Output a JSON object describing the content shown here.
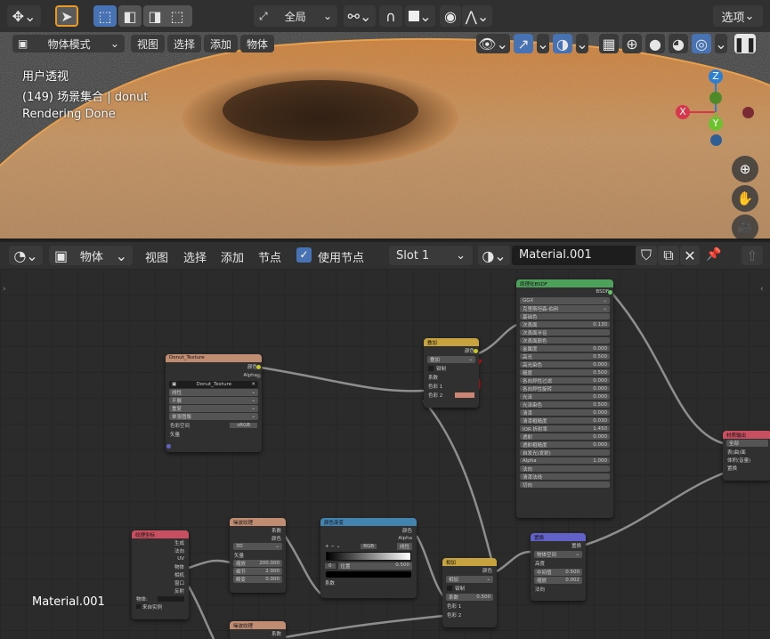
{
  "topbar": {
    "transform_orientation": "全局",
    "options_label": "选项"
  },
  "viewport": {
    "mode": "物体模式",
    "menus": [
      "视图",
      "选择",
      "添加",
      "物体"
    ],
    "overlay_lines": [
      "用户透视",
      "(149) 场景集合 | donut",
      "Rendering Done"
    ],
    "gizmo": {
      "z": "Z",
      "y": "Y",
      "x": "X"
    }
  },
  "node_header": {
    "object_label": "物体",
    "menus": [
      "视图",
      "选择",
      "添加",
      "节点"
    ],
    "use_nodes_label": "使用节点",
    "use_nodes_checked": true,
    "slot": "Slot 1",
    "material": "Material.001"
  },
  "material_name_overlay": "Material.001",
  "nodes": {
    "image_texture": {
      "title": "Donut_Texture",
      "out_color": "颜色",
      "out_alpha": "Alpha",
      "image": "Donut_Texture",
      "interp": "线性",
      "proj": "平展",
      "ext": "重复",
      "source": "单张图像",
      "colorspace_label": "色彩空间",
      "colorspace": "sRGB",
      "in_vector": "矢量"
    },
    "mix1": {
      "title": "叠加",
      "out": "颜色",
      "blend": "叠加",
      "clamp": "钳制",
      "factor": "系数",
      "c1": "色彩 1",
      "c2": "色彩 2"
    },
    "bsdf": {
      "title": "原理化BSDF",
      "out": "BSDF",
      "dist": "GGX",
      "sss_method": "克里斯坦森-伯利",
      "rows": [
        [
          "基础色",
          ""
        ],
        [
          "次表面",
          "0.130"
        ],
        [
          "次表面半径",
          ""
        ],
        [
          "次表面颜色",
          ""
        ],
        [
          "金属度",
          "0.000"
        ],
        [
          "高光",
          "0.500"
        ],
        [
          "高光染色",
          "0.000"
        ],
        [
          "糙度",
          "0.500"
        ],
        [
          "各向异性过滤",
          "0.000"
        ],
        [
          "各向异性旋转",
          "0.000"
        ],
        [
          "光泽",
          "0.000"
        ],
        [
          "光泽染色",
          "0.500"
        ],
        [
          "清漆",
          "0.000"
        ],
        [
          "清漆粗糙度",
          "0.030"
        ],
        [
          "IOR 折射率",
          "1.450"
        ],
        [
          "透射",
          "0.000"
        ],
        [
          "透射粗糙度",
          "0.000"
        ],
        [
          "自发光(发射)",
          ""
        ],
        [
          "Alpha",
          "1.000"
        ],
        [
          "法向",
          ""
        ],
        [
          "清漆法线",
          ""
        ],
        [
          "切向",
          ""
        ]
      ]
    },
    "output": {
      "title": "材质输出",
      "target": "全部",
      "surface": "表(曲)面",
      "volume": "体积(音量)",
      "disp": "置换"
    },
    "texcoord": {
      "title": "纹理坐标",
      "outs": [
        "生成",
        "法向",
        "UV",
        "物体",
        "相机",
        "窗口",
        "反射"
      ],
      "object_label": "物体:",
      "from_instancer": "来自实例"
    },
    "noise1": {
      "title": "噪波纹理",
      "out_fac": "系数",
      "out_color": "颜色",
      "dim": "3D",
      "vector": "矢量",
      "scale_l": "缩放",
      "scale": "200.000",
      "detail_l": "细节",
      "detail": "2.000",
      "rough_l": "畸变",
      "rough": "0.000"
    },
    "colorramp": {
      "title": "颜色渐变",
      "out_color": "颜色",
      "out_alpha": "Alpha",
      "mode": "RGB",
      "interp": "线性",
      "pos_idx": "0",
      "pos_l": "位置",
      "pos": "0.500",
      "fac": "系数"
    },
    "mix2": {
      "title": "相加",
      "out": "颜色",
      "blend": "相加",
      "clamp": "钳制",
      "fac_l": "系数",
      "fac": "0.500",
      "c1": "色彩 1",
      "c2": "色彩 2"
    },
    "bump": {
      "title": "置换",
      "out": "置换",
      "space": "物体空间",
      "height": "高度",
      "mid_l": "中间值",
      "mid": "0.500",
      "scale_l": "缩放",
      "scale": "0.002",
      "normal": "法向"
    },
    "noise2": {
      "title": "噪波纹理",
      "out_fac": "系数"
    }
  },
  "colors": {
    "texture_header": "#c08d73",
    "color_header": "#c6a33f",
    "shader_header": "#4ea15a",
    "output_header": "#c84f5f",
    "vector_header": "#6161c7",
    "converter_header": "#4283b0",
    "input_header": "#c84f5f"
  }
}
